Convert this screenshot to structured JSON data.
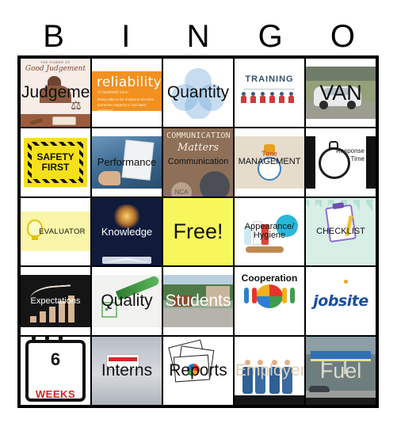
{
  "header": {
    "letters": [
      "B",
      "I",
      "N",
      "G",
      "O"
    ]
  },
  "colors": {
    "free_space": "#F7F75C",
    "grid_border": "#000000",
    "page_background": "#FFFFFF",
    "reliability_orange": "#F2911F",
    "safety_yellow": "#F6E01C",
    "evaluator_yellow": "#FAF5A9",
    "jobsite_blue": "#1B4F9C",
    "weeks_red": "#D9241F"
  },
  "grid": {
    "rows": 5,
    "columns": 5,
    "cells": [
      {
        "id": "b1",
        "label": "Judgement",
        "art": "good-judgement-poster-image",
        "art_text": {
          "top": "THE POWER OF",
          "script": "Good Judgement"
        },
        "label_style": "big"
      },
      {
        "id": "i1",
        "label": "reliability",
        "art": "reliability-definition-card-image",
        "art_text": {
          "word": "reliability",
          "ipa": "/rɪˈlaɪəbɪlɪti/ noun",
          "definition": "Being able to be trusted to do what someone expects or has been promised."
        },
        "label_style": "hidden"
      },
      {
        "id": "n1",
        "label": "Quantity",
        "art": "venn-diagram-image",
        "label_style": "big"
      },
      {
        "id": "g1",
        "label": "TRAINING",
        "art": "training-org-chart-image",
        "label_style": "hidden"
      },
      {
        "id": "o1",
        "label": "VAN",
        "art": "white-minivan-photo",
        "label_style": "huge"
      },
      {
        "id": "b2",
        "label": "SAFETY FIRST",
        "art": "safety-first-hazard-sign-image",
        "label_style": "hidden"
      },
      {
        "id": "i2",
        "label": "Performance",
        "art": "performance-review-photo",
        "label_style": "normal"
      },
      {
        "id": "n2",
        "label": "Communication",
        "art": "communication-matters-poster-image",
        "art_text": {
          "line1": "COMMUNICATION",
          "line2": "Matters",
          "logo": "NCA"
        },
        "label_style": "small"
      },
      {
        "id": "g2",
        "label": "MANAGEMENT",
        "art": "time-management-clock-image",
        "art_text": {
          "overline": "Time"
        },
        "label_style": "small"
      },
      {
        "id": "o2",
        "label": "Response Time",
        "art": "stopwatch-image",
        "label_style": "hidden"
      },
      {
        "id": "b3",
        "label": "EVALUATOR",
        "art": "lightbulb-yellow-banner-image",
        "label_style": "tiny"
      },
      {
        "id": "i3",
        "label": "Knowledge",
        "art": "glowing-open-book-photo",
        "label_style": "normal"
      },
      {
        "id": "n3",
        "label": "Free!",
        "art": "free-space",
        "label_style": "huge"
      },
      {
        "id": "g3",
        "label": "Appearance/ Hygiene",
        "art": "hygiene-toiletries-image",
        "label_style": "small-wrap"
      },
      {
        "id": "o3",
        "label": "CHECKLIST",
        "art": "clipboard-checklist-image",
        "label_style": "small"
      },
      {
        "id": "b4",
        "label": "Expectations",
        "art": "rising-bar-chart-photo",
        "label_style": "small"
      },
      {
        "id": "i4",
        "label": "Quality",
        "art": "quality-checkmark-pen-image",
        "label_style": "big"
      },
      {
        "id": "n4",
        "label": "Students",
        "art": "campus-entrance-photo",
        "label_style": "big-white"
      },
      {
        "id": "g4",
        "label": "Cooperation",
        "art": "puzzle-teamwork-clipart",
        "label_style": "small"
      },
      {
        "id": "o4",
        "label": "jobsite",
        "art": "jobsite-logo",
        "label_style": "hidden"
      },
      {
        "id": "b5",
        "label": "6 WEEKS",
        "art": "six-weeks-calendar-icon",
        "art_text": {
          "number": "6",
          "unit": "WEEKS"
        },
        "label_style": "hidden"
      },
      {
        "id": "i5",
        "label": "Interns",
        "art": "interns-card-photo",
        "label_style": "big"
      },
      {
        "id": "n5",
        "label": "Reports",
        "art": "report-documents-clipart",
        "label_style": "big"
      },
      {
        "id": "g5",
        "label": "Employer",
        "art": "businessmen-handshake-clipart",
        "label_style": "big-faint"
      },
      {
        "id": "o5",
        "label": "Fuel",
        "art": "gas-station-photo",
        "label_style": "huge-faint"
      }
    ]
  }
}
